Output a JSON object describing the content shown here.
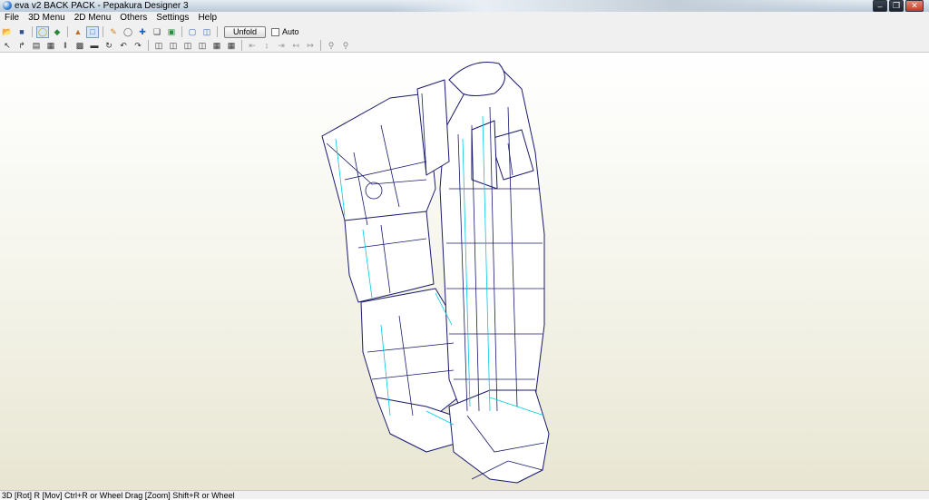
{
  "window": {
    "title": "eva v2 BACK PACK - Pepakura Designer 3",
    "controls": [
      "minimize",
      "maximize",
      "close"
    ]
  },
  "menu": [
    "File",
    "3D Menu",
    "2D Menu",
    "Others",
    "Settings",
    "Help"
  ],
  "toolbar1": {
    "buttons": [
      "open-icon",
      "save-icon",
      "light-icon",
      "paint-icon",
      "texture-icon",
      "view-box-icon",
      "edit-pencil-icon",
      "cylinder-icon",
      "move-axes-icon",
      "copy-icon",
      "flap-icon",
      "window-single-icon",
      "window-split-icon"
    ],
    "unfold_label": "Unfold",
    "auto_label": "Auto",
    "auto_checked": false
  },
  "toolbar2": {
    "buttons": [
      "select-icon",
      "vertex-icon",
      "brush-icon",
      "join-icon",
      "pin-icon",
      "fold-icon",
      "rect-icon",
      "rotate-icon",
      "undo-icon",
      "redo-icon",
      "grid-a-icon",
      "grid-b-icon",
      "grid-c-icon",
      "grid-d-icon",
      "grid-e-icon",
      "grid-f-icon",
      "align-left-icon",
      "align-center-icon",
      "align-right-icon",
      "align-top-icon",
      "align-bottom-icon",
      "zoom-in-icon",
      "zoom-out-icon"
    ]
  },
  "status": {
    "text": "3D [Rot] R [Mov] Ctrl+R or Wheel Drag [Zoom] Shift+R or Wheel"
  },
  "model": {
    "name": "eva v2 BACK PACK",
    "edge_color": "#1a1a6e",
    "fold_color": "#00c8e0",
    "face_color": "#ffffff"
  }
}
